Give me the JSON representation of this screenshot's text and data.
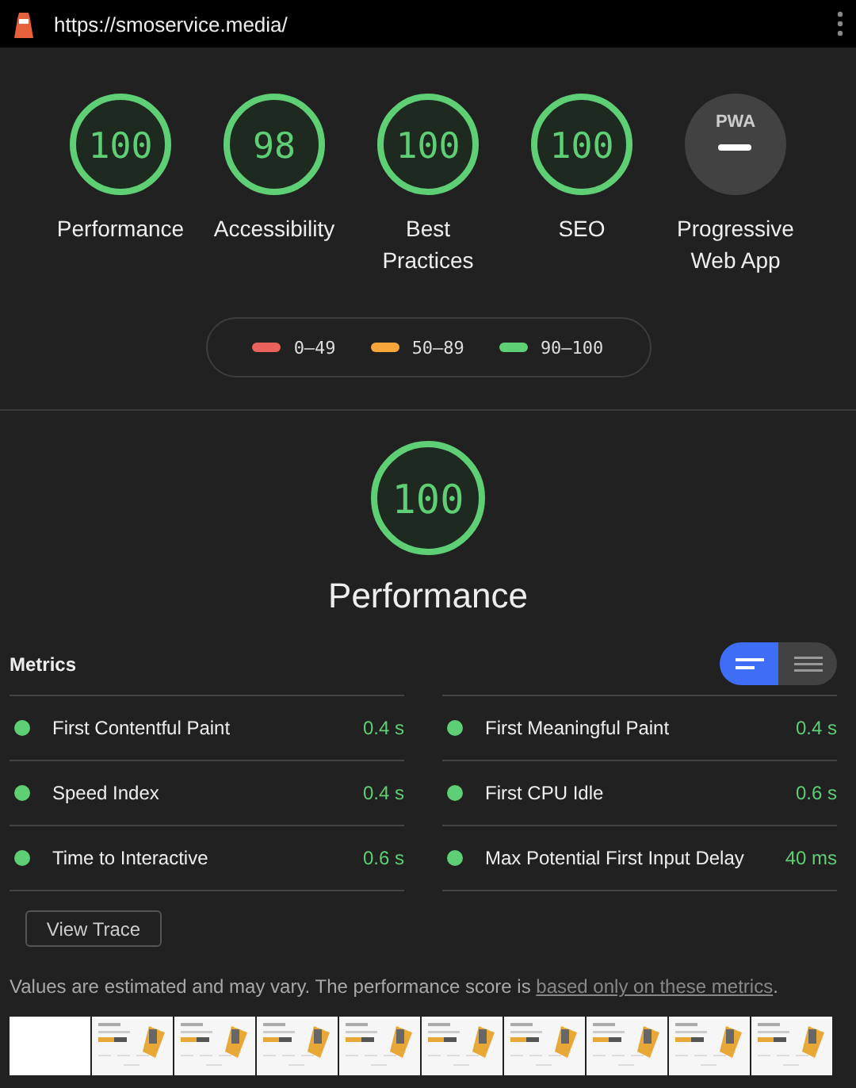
{
  "address_bar": {
    "url": "https://smoservice.media/"
  },
  "gauges": [
    {
      "kind": "score",
      "score": "100",
      "label": "Performance"
    },
    {
      "kind": "score",
      "score": "98",
      "label": "Accessibility"
    },
    {
      "kind": "score",
      "score": "100",
      "label": "Best Practices"
    },
    {
      "kind": "score",
      "score": "100",
      "label": "SEO"
    },
    {
      "kind": "pwa",
      "badge": "PWA",
      "label": "Progressive Web App"
    }
  ],
  "legend": [
    {
      "range": "0–49",
      "color": "#e8615a"
    },
    {
      "range": "50–89",
      "color": "#f7a73a"
    },
    {
      "range": "90–100",
      "color": "#5fcf75"
    }
  ],
  "category": {
    "score": "100",
    "title": "Performance"
  },
  "metrics": {
    "heading": "Metrics",
    "view_toggle": [
      {
        "kind": "compact",
        "selected": true
      },
      {
        "kind": "list",
        "selected": false
      }
    ],
    "items": [
      {
        "name": "First Contentful Paint",
        "value": "0.4 s",
        "color": "#5fcf75"
      },
      {
        "name": "First Meaningful Paint",
        "value": "0.4 s",
        "color": "#5fcf75"
      },
      {
        "name": "Speed Index",
        "value": "0.4 s",
        "color": "#5fcf75"
      },
      {
        "name": "First CPU Idle",
        "value": "0.6 s",
        "color": "#5fcf75"
      },
      {
        "name": "Time to Interactive",
        "value": "0.6 s",
        "color": "#5fcf75"
      },
      {
        "name": "Max Potential First Input Delay",
        "value": "40 ms",
        "color": "#5fcf75"
      }
    ],
    "button": "View Trace",
    "note": {
      "text": "Values are estimated and may vary. The performance score is ",
      "link": "based only on these metrics",
      "end": "."
    }
  },
  "filmstrip": [
    {
      "kind": "blank"
    },
    {
      "kind": "picture"
    },
    {
      "kind": "picture"
    },
    {
      "kind": "picture"
    },
    {
      "kind": "picture"
    },
    {
      "kind": "picture"
    },
    {
      "kind": "picture"
    },
    {
      "kind": "picture"
    },
    {
      "kind": "picture"
    },
    {
      "kind": "picture"
    }
  ]
}
